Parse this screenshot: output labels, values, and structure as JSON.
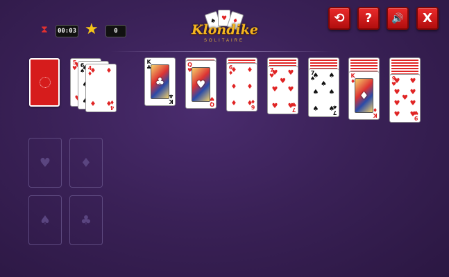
{
  "hud": {
    "timer": "00:03",
    "score": "0",
    "timer_icon": "hourglass-icon",
    "score_icon": "star-icon"
  },
  "logo": {
    "title": "Klondike",
    "subtitle": "SOLITAIRE"
  },
  "controls": [
    {
      "name": "restart-button",
      "icon": "restart-icon",
      "glyph": "⟲"
    },
    {
      "name": "help-button",
      "icon": "help-icon",
      "glyph": "?"
    },
    {
      "name": "sound-button",
      "icon": "speaker-icon",
      "glyph": "🔊"
    },
    {
      "name": "close-button",
      "icon": "close-icon",
      "glyph": "X"
    }
  ],
  "stock": {
    "state": "face-down"
  },
  "waste": [
    {
      "rank": "5",
      "suit": "♥",
      "color": "red"
    },
    {
      "rank": "6",
      "suit": "♠",
      "color": "black"
    },
    {
      "rank": "4",
      "suit": "♦",
      "color": "red"
    }
  ],
  "foundations": [
    {
      "suit": "♥"
    },
    {
      "suit": "♦"
    },
    {
      "suit": "♠"
    },
    {
      "suit": "♣"
    }
  ],
  "tableau": [
    {
      "hidden": 0,
      "top": {
        "rank": "K",
        "suit": "♣",
        "color": "black",
        "face": true
      }
    },
    {
      "hidden": 1,
      "top": {
        "rank": "Q",
        "suit": "♥",
        "color": "red",
        "face": true
      }
    },
    {
      "hidden": 2,
      "top": {
        "rank": "6",
        "suit": "♦",
        "color": "red",
        "face": false
      }
    },
    {
      "hidden": 3,
      "top": {
        "rank": "7",
        "suit": "♥",
        "color": "red",
        "face": false
      }
    },
    {
      "hidden": 4,
      "top": {
        "rank": "7",
        "suit": "♠",
        "color": "black",
        "face": false
      }
    },
    {
      "hidden": 5,
      "top": {
        "rank": "K",
        "suit": "♦",
        "color": "red",
        "face": true
      }
    },
    {
      "hidden": 6,
      "top": {
        "rank": "9",
        "suit": "♥",
        "color": "red",
        "face": false
      }
    }
  ],
  "colors": {
    "background": "#3a2157",
    "button_red": "#d91b1b",
    "card_red": "#e02424",
    "logo_gold": "#f3b521"
  }
}
